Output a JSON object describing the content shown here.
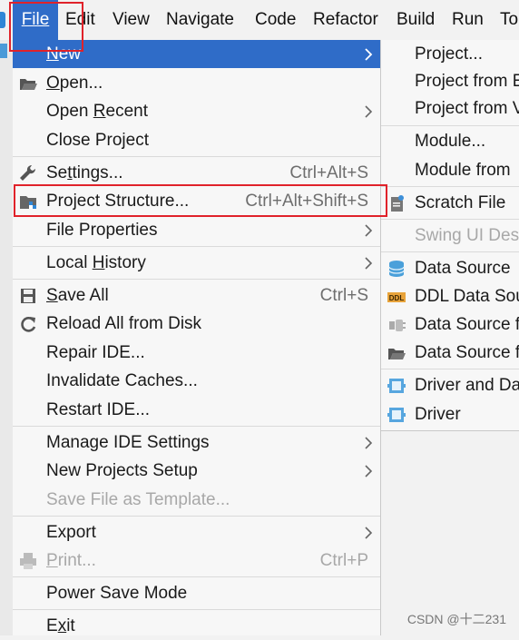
{
  "menubar": {
    "items": [
      {
        "text": "File",
        "mnemonic_first": true
      },
      {
        "text": "Edit"
      },
      {
        "text": "View"
      },
      {
        "text": "Navigate"
      },
      {
        "text": "Code"
      },
      {
        "text": "Refactor"
      },
      {
        "text": "Build"
      },
      {
        "text": "Run"
      },
      {
        "text": "To"
      }
    ]
  },
  "file_menu": {
    "new": {
      "pre": "",
      "mn": "N",
      "post": "ew"
    },
    "open": {
      "pre": "",
      "mn": "O",
      "post": "pen..."
    },
    "open_recent": {
      "pre": "Open ",
      "mn": "R",
      "post": "ecent"
    },
    "close_project": {
      "label": "Close Project"
    },
    "settings": {
      "pre": "Se",
      "mn": "t",
      "post": "tings...",
      "shortcut": "Ctrl+Alt+S"
    },
    "project_structure": {
      "label": "Project Structure...",
      "shortcut": "Ctrl+Alt+Shift+S"
    },
    "file_properties": {
      "label": "File Properties"
    },
    "local_history": {
      "pre": "Local ",
      "mn": "H",
      "post": "istory"
    },
    "save_all": {
      "pre": "",
      "mn": "S",
      "post": "ave All",
      "shortcut": "Ctrl+S"
    },
    "reload_all": {
      "label": "Reload All from Disk"
    },
    "repair_ide": {
      "label": "Repair IDE..."
    },
    "invalidate_caches": {
      "label": "Invalidate Caches..."
    },
    "restart_ide": {
      "label": "Restart IDE..."
    },
    "manage_ide_settings": {
      "label": "Manage IDE Settings"
    },
    "new_projects_setup": {
      "label": "New Projects Setup"
    },
    "save_as_template": {
      "label": "Save File as Template..."
    },
    "export": {
      "label": "Export"
    },
    "print": {
      "pre": "",
      "mn": "P",
      "post": "rint...",
      "shortcut": "Ctrl+P"
    },
    "power_save": {
      "label": "Power Save Mode"
    },
    "exit": {
      "pre": "E",
      "mn": "x",
      "post": "it"
    }
  },
  "new_submenu": {
    "project": "Project...",
    "project_from_e": "Project from E",
    "project_from_v": "Project from V",
    "module": "Module...",
    "module_from": "Module from",
    "scratch_file": "Scratch File",
    "swing_ui": "Swing UI Desi",
    "data_source": "Data Source",
    "ddl_data_source": "DDL Data Sou",
    "data_source_f1": "Data Source f",
    "data_source_f2": "Data Source f",
    "driver_and_data": "Driver and Da",
    "driver": "Driver"
  },
  "colors": {
    "selection": "#2f6cc8",
    "annotation_red": "#e0222a"
  },
  "watermark": "CSDN @十二231"
}
